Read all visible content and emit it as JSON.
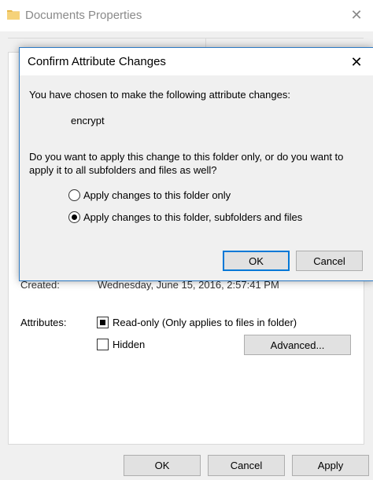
{
  "properties": {
    "title": "Documents Properties",
    "created_label": "Created:",
    "created_value": "Wednesday, June 15, 2016, 2:57:41 PM",
    "attributes_label": "Attributes:",
    "readonly_label": "Read-only (Only applies to files in folder)",
    "hidden_label": "Hidden",
    "advanced_label": "Advanced...",
    "ok_label": "OK",
    "cancel_label": "Cancel",
    "apply_label": "Apply"
  },
  "dialog": {
    "title": "Confirm Attribute Changes",
    "intro": "You have chosen to make the following attribute changes:",
    "change": "encrypt",
    "question_line1": "Do you want to apply this change to this folder only, or do you want to",
    "question_line2": "apply it to all subfolders and files as well?",
    "option_folder_only": "Apply changes to this folder only",
    "option_all": "Apply changes to this folder, subfolders and files",
    "ok_label": "OK",
    "cancel_label": "Cancel"
  },
  "colors": {
    "accent": "#0078d7",
    "dialog_border": "#2b79c4",
    "folder_icon": "#e8b84a"
  }
}
